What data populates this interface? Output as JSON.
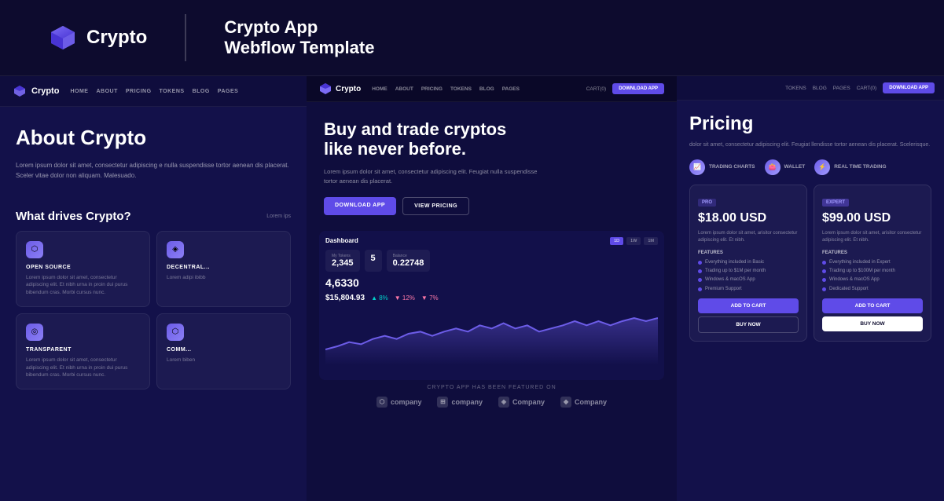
{
  "header": {
    "logo_text": "Crypto",
    "tagline_line1": "Crypto App",
    "tagline_line2": "Webflow Template"
  },
  "left_panel": {
    "nav": {
      "brand": "Crypto",
      "links": [
        "HOME",
        "ABOUT",
        "PRICING",
        "TOKENS",
        "BLOG",
        "PAGES"
      ]
    },
    "title": "About Crypto",
    "description": "Lorem ipsum dolor sit amet, consectetur adipiscing e nulla suspendisse tortor aenean dis placerat. Sceler vitae dolor non aliquam. Malesuado.",
    "section_title": "What drives Crypto?",
    "section_desc": "Lorem ips",
    "features": [
      {
        "title": "OPEN SOURCE",
        "text": "Lorem ipsum dolor sit amet, consectetur adipiscing elit. Et nibh urna in proin dui purus bibendum cras. Morbi cursus nunc.",
        "icon": "⬡"
      },
      {
        "title": "DECENTRAL...",
        "text": "Lorem adipi ibibb",
        "icon": "◈"
      },
      {
        "title": "TRANSPARENT",
        "text": "Lorem ipsum dolor sit amet, consectetur adipiscing elit. Et nibh urna in proin dui purus bibendum cras. Morbi cursus nunc.",
        "icon": "◎"
      },
      {
        "title": "COMM...",
        "text": "Lorem biben",
        "icon": "⬡"
      }
    ]
  },
  "center_panel": {
    "nav": {
      "brand": "Crypto",
      "links": [
        "HOME",
        "ABOUT",
        "PRICING",
        "TOKENS",
        "BLOG",
        "PAGES"
      ],
      "cart_label": "CART(0)",
      "dl_btn": "DOWNLOAD APP"
    },
    "hero_title_line1": "Buy and trade cryptos",
    "hero_title_line2": "like never before.",
    "hero_desc": "Lorem ipsum dolor sit amet, consectetur adipiscing elit. Feugiat nulla suspendisse tortor aenean dis placerat.",
    "btn_primary": "DOWNLOAD APP",
    "btn_outline": "VIEW PRICING",
    "dashboard": {
      "title": "Dashboard",
      "stats": [
        {
          "label": "My Tokens",
          "value": "2,345"
        },
        {
          "label": "",
          "value": "5"
        },
        {
          "label": "Balance",
          "value": "0.22748"
        }
      ],
      "big_value": "4,6330",
      "price": "$15,804.93"
    },
    "featured_text": "CRYPTO APP HAS BEEN FEATURED ON",
    "companies": [
      "company",
      "company",
      "Company",
      "Company"
    ]
  },
  "right_panel": {
    "nav": {
      "links": [
        "TOKENS",
        "BLOG",
        "PAGES"
      ],
      "cart_label": "CART(0)",
      "dl_btn": "DOWNLOAD APP"
    },
    "title": "Pricing",
    "description": "dolor sit amet, consectetur adipiscing elit. Feugiat llendisse tortor aenean dis placerat. Scelerisque.",
    "features_bar": [
      "TRADING CHARTS",
      "WALLET",
      "REAL TIME TRADING"
    ],
    "cards": [
      {
        "tier": "PRO",
        "tier_class": "pro",
        "price": "$18.00 USD",
        "desc": "Lorem ipsum dolor sit amet, arisitor consectetur adipiscing elit. Et nibh.",
        "features_label": "FEATURES",
        "features": [
          "Everything included in Basic",
          "Trading up to $1M per month",
          "Windows & macOS App",
          "Premium Support"
        ],
        "btn_add": "ADD TO CART",
        "btn_buy": "BUY NOW"
      },
      {
        "tier": "EXPERT",
        "tier_class": "expert",
        "price": "$99.00 USD",
        "desc": "Lorem ipsum dolor sit amet, arisitor consectetur adipiscing elit. Et nibh.",
        "features_label": "FEATURES",
        "features": [
          "Everything included in Expert",
          "Trading up to $100M per month",
          "Windows & macOS App",
          "Dedicated Support"
        ],
        "btn_add": "ADD TO CART",
        "btn_buy": "BUY NOW"
      }
    ]
  }
}
